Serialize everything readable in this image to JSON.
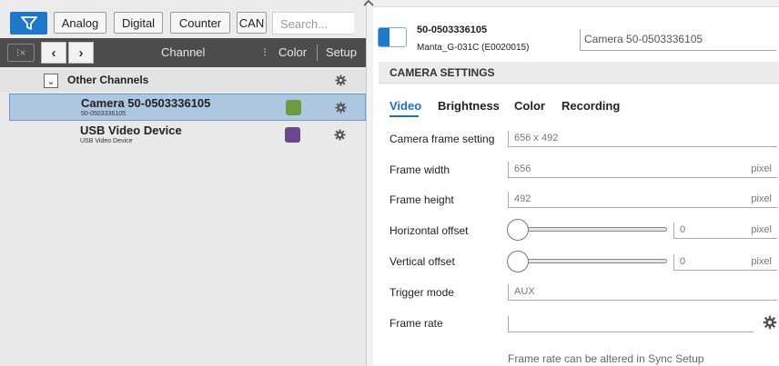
{
  "filterbar": {
    "tags": [
      "Analog",
      "Digital",
      "Counter",
      "CAN"
    ],
    "search_placeholder": "Search..."
  },
  "channel_header": {
    "channel_label": "Channel",
    "color_label": "Color",
    "setup_label": "Setup"
  },
  "group": {
    "label": "Other Channels"
  },
  "channels": [
    {
      "name": "Camera 50-0503336105",
      "sub": "50-0503336105",
      "color": "#6e9a41",
      "selected": true
    },
    {
      "name": "USB Video Device",
      "sub": "USB Video Device",
      "color": "#6d478c",
      "selected": false
    }
  ],
  "device": {
    "id": "50-0503336105",
    "model": "Manta_G-031C (E0020015)",
    "display_name": "Camera 50-0503336105"
  },
  "section_title": "CAMERA SETTINGS",
  "tabs": [
    "Video",
    "Brightness",
    "Color",
    "Recording"
  ],
  "form": {
    "frame_setting_label": "Camera frame setting",
    "frame_setting_value": "656 x 492",
    "frame_width_label": "Frame width",
    "frame_width_value": "656",
    "frame_height_label": "Frame height",
    "frame_height_value": "492",
    "h_offset_label": "Horizontal offset",
    "h_offset_value": "0",
    "v_offset_label": "Vertical offset",
    "v_offset_value": "0",
    "trigger_label": "Trigger mode",
    "trigger_value": "AUX",
    "frame_rate_label": "Frame rate",
    "frame_rate_value": "",
    "unit": "pixel"
  },
  "note": "Frame rate can be altered in Sync Setup",
  "colors": {
    "accent": "#1f78c8",
    "selected_row": "#aec7e0",
    "header_bg": "#4c4c4c"
  }
}
